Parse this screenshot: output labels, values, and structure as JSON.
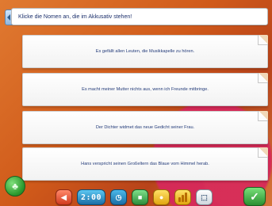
{
  "prompt": {
    "text": "Klicke die Nomen an, die im Akkusativ stehen!"
  },
  "sentences": [
    "Es gefällt allen Leuten, die Musikkapelle zu hören.",
    "Es macht meiner Mutter nichts aus, wenn ich Freunde mitbringe.",
    "Der Dichter widmet das neue Gedicht seiner Frau.",
    "Hans verspricht seinen Großeltern das Blaue vom Himmel herab."
  ],
  "toolbar": {
    "time": "2:00",
    "icons": [
      "back-icon",
      "clock-icon",
      "stop-icon",
      "coin-icon",
      "stats-icon",
      "toggle-icon"
    ]
  },
  "footer": {
    "check_symbol": "✓",
    "left_symbol": "♣"
  },
  "colors": {
    "accent_blue": "#1b6ea5",
    "text_blue": "#243c7a",
    "ok_green": "#2a8f31"
  }
}
